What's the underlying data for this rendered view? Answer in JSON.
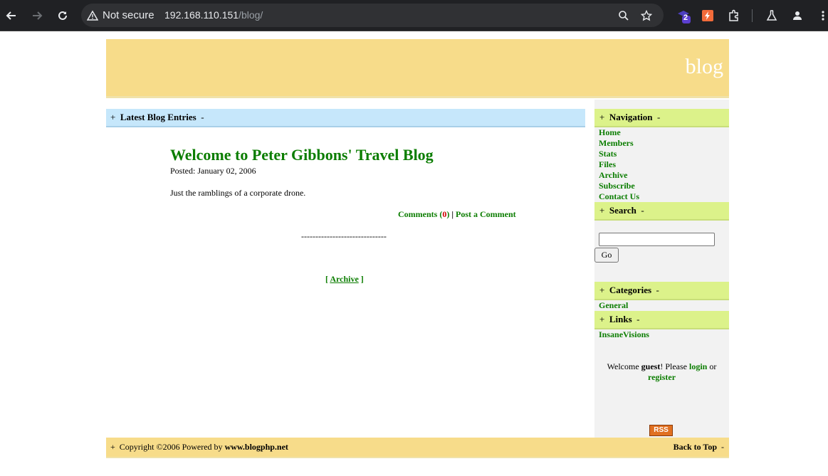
{
  "browser": {
    "security_label": "Not secure",
    "url_host": "192.168.110.151",
    "url_path": "/blog/",
    "extension_badge": "2"
  },
  "header": {
    "title": "blog"
  },
  "main": {
    "section_label": "Latest Blog Entries",
    "entry": {
      "title": "Welcome to Peter Gibbons' Travel Blog",
      "date": "Posted: January 02, 2006",
      "body": "Just the ramblings of a corporate drone.",
      "comments_label": "Comments",
      "comments_count": "0",
      "separator": "|",
      "post_comment_label": "Post a Comment",
      "divider": "------------------------------"
    },
    "archive": {
      "open": "[",
      "label": "Archive",
      "close": "]"
    }
  },
  "sidebar": {
    "navigation": {
      "heading": "Navigation",
      "items": [
        "Home",
        "Members",
        "Stats",
        "Files",
        "Archive",
        "Subscribe",
        "Contact Us"
      ]
    },
    "search": {
      "heading": "Search",
      "value": "",
      "button": "Go"
    },
    "categories": {
      "heading": "Categories",
      "items": [
        "General"
      ]
    },
    "links": {
      "heading": "Links",
      "items": [
        "InsaneVisions"
      ]
    },
    "welcome": {
      "prefix": "Welcome ",
      "user": "guest",
      "mid": "! Please ",
      "login": "login",
      "or": " or",
      "register": "register"
    },
    "rss_label": "RSS"
  },
  "footer": {
    "prefix": "Copyright ©2006 Powered by ",
    "link": "www.blogphp.net",
    "back_to_top": "Back to Top"
  },
  "colors": {
    "header_bg": "#f7dc8a",
    "main_bar": "#c6e7fb",
    "side_bar": "#dcf28a",
    "link": "#0b7d00"
  }
}
